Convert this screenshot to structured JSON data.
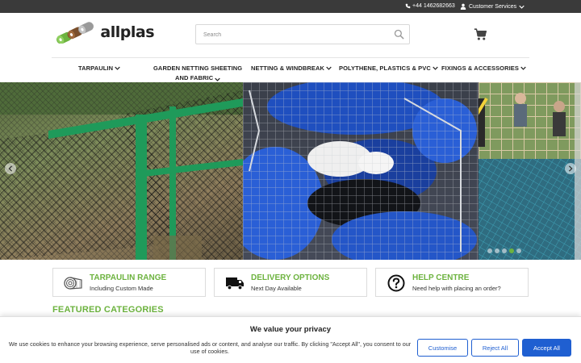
{
  "topbar": {
    "phone": "+44 1462682663",
    "customer_services": "Customer Services"
  },
  "header": {
    "logo_text": "allplas",
    "search_placeholder": "Search"
  },
  "nav": {
    "items": [
      {
        "label": "TARPAULIN"
      },
      {
        "label_line1": "GARDEN NETTING SHEETING",
        "label_line2": "AND FABRIC"
      },
      {
        "label": "NETTING & WINDBREAK"
      },
      {
        "label": "POLYTHENE, PLASTICS & PVC"
      },
      {
        "label": "FIXINGS & ACCESSORIES"
      }
    ]
  },
  "hero": {
    "active_slide": 4,
    "slide_count": 5
  },
  "features": [
    {
      "title": "TARPAULIN RANGE",
      "subtitle": "Including Custom Made",
      "icon": "tarpaulin-roll-icon"
    },
    {
      "title": "DELIVERY OPTIONS",
      "subtitle": "Next Day Available",
      "icon": "truck-icon"
    },
    {
      "title": "HELP CENTRE",
      "subtitle": "Need help with placing an order?",
      "icon": "help-question-icon"
    }
  ],
  "featured_categories_title": "FEATURED CATEGORIES",
  "cookie": {
    "title": "We value your privacy",
    "body": "We use cookies to enhance your browsing experience, serve personalised ads or content, and analyse our traffic. By clicking \"Accept All\", you consent to our use of cookies.",
    "customise": "Customise",
    "reject": "Reject All",
    "accept": "Accept All"
  },
  "colors": {
    "accent_green": "#6db33f",
    "topbar": "#3a3a3a",
    "cookie_blue": "#1f5fd1"
  }
}
